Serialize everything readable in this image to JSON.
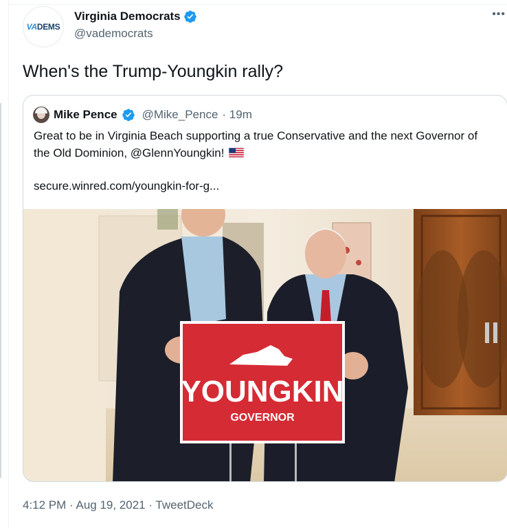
{
  "tweet": {
    "author": {
      "display_name": "Virginia Democrats",
      "handle": "@vademocrats",
      "avatar_text_va": "VA",
      "avatar_text_dems": "DEMS"
    },
    "text": "When's the Trump-Youngkin rally?",
    "more_label": "•••",
    "timestamp_line": "4:12 PM · Aug 19, 2021 · TweetDeck"
  },
  "quoted": {
    "display_name": "Mike Pence",
    "handle": "@Mike_Pence",
    "age": "· 19m",
    "text": "Great to be in Virginia Beach supporting a true Conservative and the next Governor of the Old Dominion, @GlennYoungkin!",
    "link": "secure.winred.com/youngkin-for-g...",
    "photo": {
      "sign_title": "YOUNGKIN",
      "sign_subtitle": "GOVERNOR"
    }
  },
  "colors": {
    "verified": "#1d9bf0",
    "sign_red": "#d52b34",
    "secondary_text": "#536471"
  }
}
